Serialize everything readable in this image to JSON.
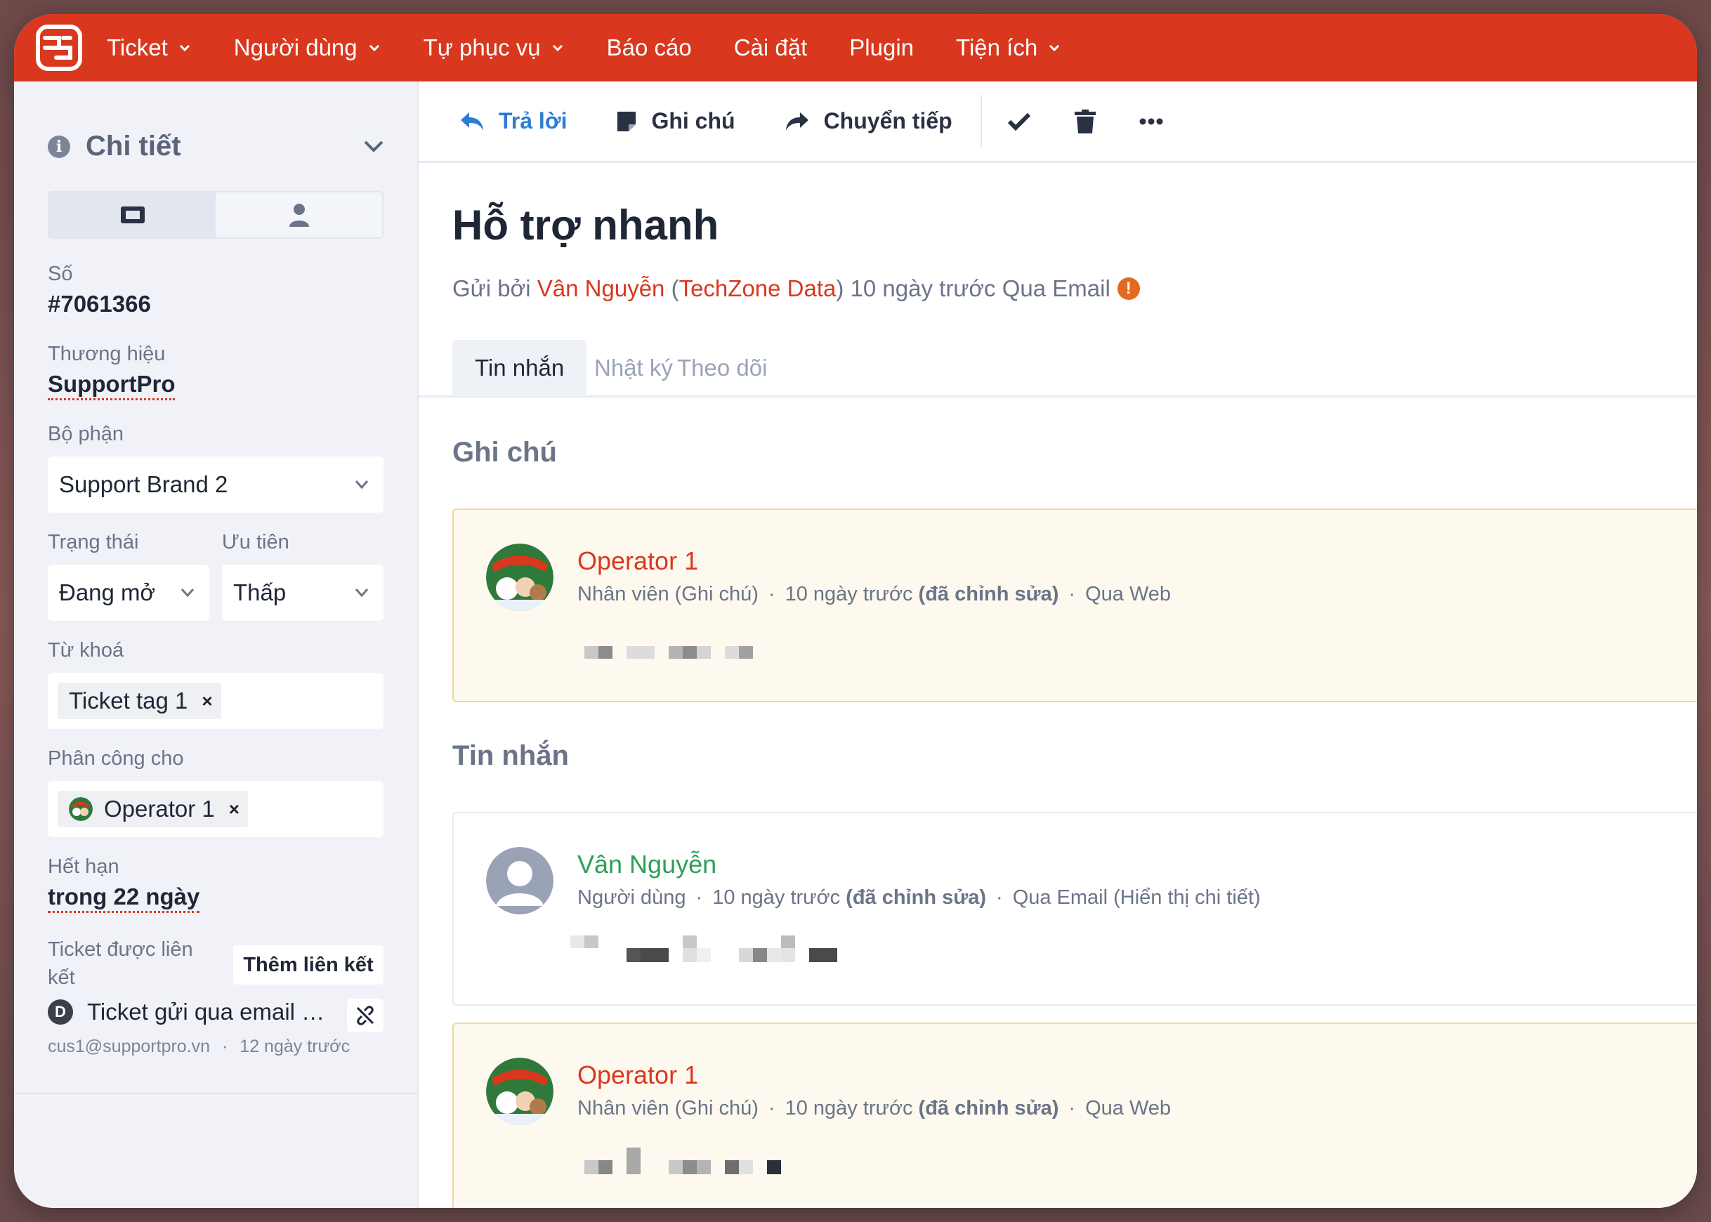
{
  "nav": {
    "items": [
      {
        "label": "Ticket",
        "has_dropdown": true
      },
      {
        "label": "Người dùng",
        "has_dropdown": true
      },
      {
        "label": "Tự phục vụ",
        "has_dropdown": true
      },
      {
        "label": "Báo cáo",
        "has_dropdown": false
      },
      {
        "label": "Cài đặt",
        "has_dropdown": false
      },
      {
        "label": "Plugin",
        "has_dropdown": false
      },
      {
        "label": "Tiện ích",
        "has_dropdown": true
      }
    ]
  },
  "sidebar": {
    "title": "Chi tiết",
    "number_label": "Số",
    "number_value": "#7061366",
    "brand_label": "Thương hiệu",
    "brand_value": "SupportPro",
    "department_label": "Bộ phận",
    "department_value": "Support Brand 2",
    "status_label": "Trạng thái",
    "status_value": "Đang mở",
    "priority_label": "Ưu tiên",
    "priority_value": "Thấp",
    "tags_label": "Từ khoá",
    "tag_value": "Ticket tag 1",
    "assign_label": "Phân công cho",
    "assign_value": "Operator 1",
    "due_label": "Hết hạn",
    "due_value": "trong 22 ngày",
    "linked_label": "Ticket được liên kết",
    "add_link_label": "Thêm liên kết",
    "linked_ticket": {
      "badge": "D",
      "title": "Ticket gửi qua email chưa đăng nhập",
      "email": "cus1@supportpro.vn",
      "time": "12 ngày trước"
    }
  },
  "toolbar": {
    "reply_label": "Trả lời",
    "note_label": "Ghi chú",
    "forward_label": "Chuyển tiếp"
  },
  "ticket": {
    "title": "Hỗ trợ nhanh",
    "sent_prefix": "Gửi bởi",
    "sender_name": "Vân Nguyễn",
    "sender_org": "TechZone Data",
    "sent_suffix": "10 ngày trước Qua Email"
  },
  "tabs": [
    {
      "label": "Tin nhắn",
      "active": true
    },
    {
      "label": "Nhật ký",
      "active": false
    },
    {
      "label": "Theo dõi",
      "active": false
    }
  ],
  "notes_section": {
    "title": "Ghi chú",
    "items": [
      {
        "name": "Operator 1",
        "role": "Nhân viên (Ghi chú)",
        "time": "10 ngày trước",
        "edited": "(đã chỉnh sửa)",
        "channel": "Qua Web"
      }
    ]
  },
  "messages_section": {
    "title": "Tin nhắn",
    "items": [
      {
        "name": "Vân Nguyễn",
        "role": "Người dùng",
        "time": "10 ngày trước",
        "edited": "(đã chỉnh sửa)",
        "channel": "Qua Email (Hiển thị chi tiết)"
      },
      {
        "name": "Operator 1",
        "role": "Nhân viên (Ghi chú)",
        "time": "10 ngày trước",
        "edited": "(đã chỉnh sửa)",
        "channel": "Qua Web"
      }
    ]
  },
  "colors": {
    "brand_red": "#d9381e",
    "link_blue": "#2f7dd1",
    "user_green": "#2f9e5a"
  },
  "icons": {
    "logo": "sf-logo",
    "info": "info-icon",
    "ticket_tab": "ticket-icon",
    "user_tab": "user-icon",
    "reply": "reply-icon",
    "note": "note-icon",
    "forward": "forward-icon",
    "resolve": "check-icon",
    "delete": "trash-icon",
    "more": "more-icon",
    "unlink": "unlink-icon"
  }
}
